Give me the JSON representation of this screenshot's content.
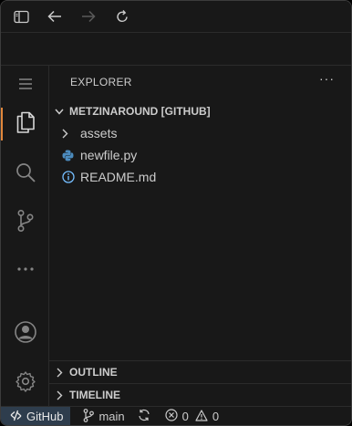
{
  "titlebar": {
    "icons": [
      "sidebar-toggle-icon",
      "arrow-left-icon",
      "arrow-right-icon",
      "refresh-icon"
    ]
  },
  "activity_bar": {
    "items": [
      "menu-icon",
      "files-icon",
      "search-icon",
      "source-control-icon",
      "more-icon",
      "account-icon",
      "settings-icon"
    ],
    "active": "files-icon",
    "active_color": "#e1873b"
  },
  "explorer": {
    "title": "EXPLORER",
    "more_label": "···",
    "repo": {
      "title": "METZINAROUND [GITHUB]",
      "items": [
        {
          "label": "assets",
          "icon": "chevron-right-icon"
        },
        {
          "label": "newfile.py",
          "icon": "python-icon"
        },
        {
          "label": "README.md",
          "icon": "info-icon"
        }
      ]
    },
    "outline_title": "OUTLINE",
    "timeline_title": "TIMELINE"
  },
  "statusbar": {
    "remote_label": "GitHub",
    "branch": "main",
    "errors": "0",
    "warnings": "0",
    "remote_bg": "#2e3d4d"
  }
}
